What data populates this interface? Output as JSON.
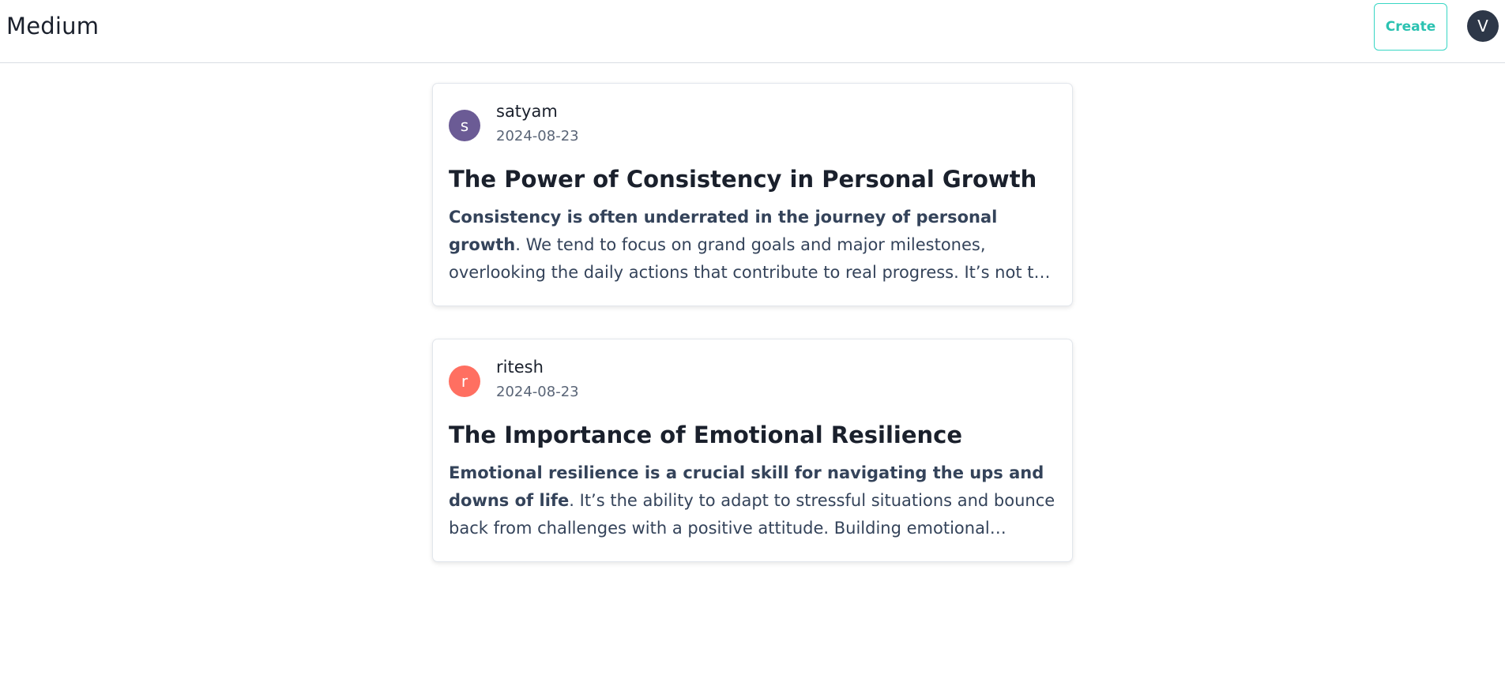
{
  "header": {
    "brand": "Medium",
    "create_label": "Create",
    "user_initial": "V"
  },
  "posts": [
    {
      "author_initial": "s",
      "author": "satyam",
      "avatar_color": "#6b5b95",
      "date": "2024-08-23",
      "title": "The Power of Consistency in Personal Growth",
      "excerpt_bold": "Consistency is often underrated in the journey of personal growth",
      "excerpt_rest": ". We tend to focus on grand goals and major milestones, overlooking the daily actions that contribute to real progress. It’s not the occasional burst of effort that leads to lasting change"
    },
    {
      "author_initial": "r",
      "author": "ritesh",
      "avatar_color": "#ff6f61",
      "date": "2024-08-23",
      "title": "The Importance of Emotional Resilience",
      "excerpt_bold": "Emotional resilience is a crucial skill for navigating the ups and downs of life",
      "excerpt_rest": ". It’s the ability to adapt to stressful situations and bounce back from challenges with a positive attitude. Building emotional resilience takes time and practice"
    }
  ]
}
